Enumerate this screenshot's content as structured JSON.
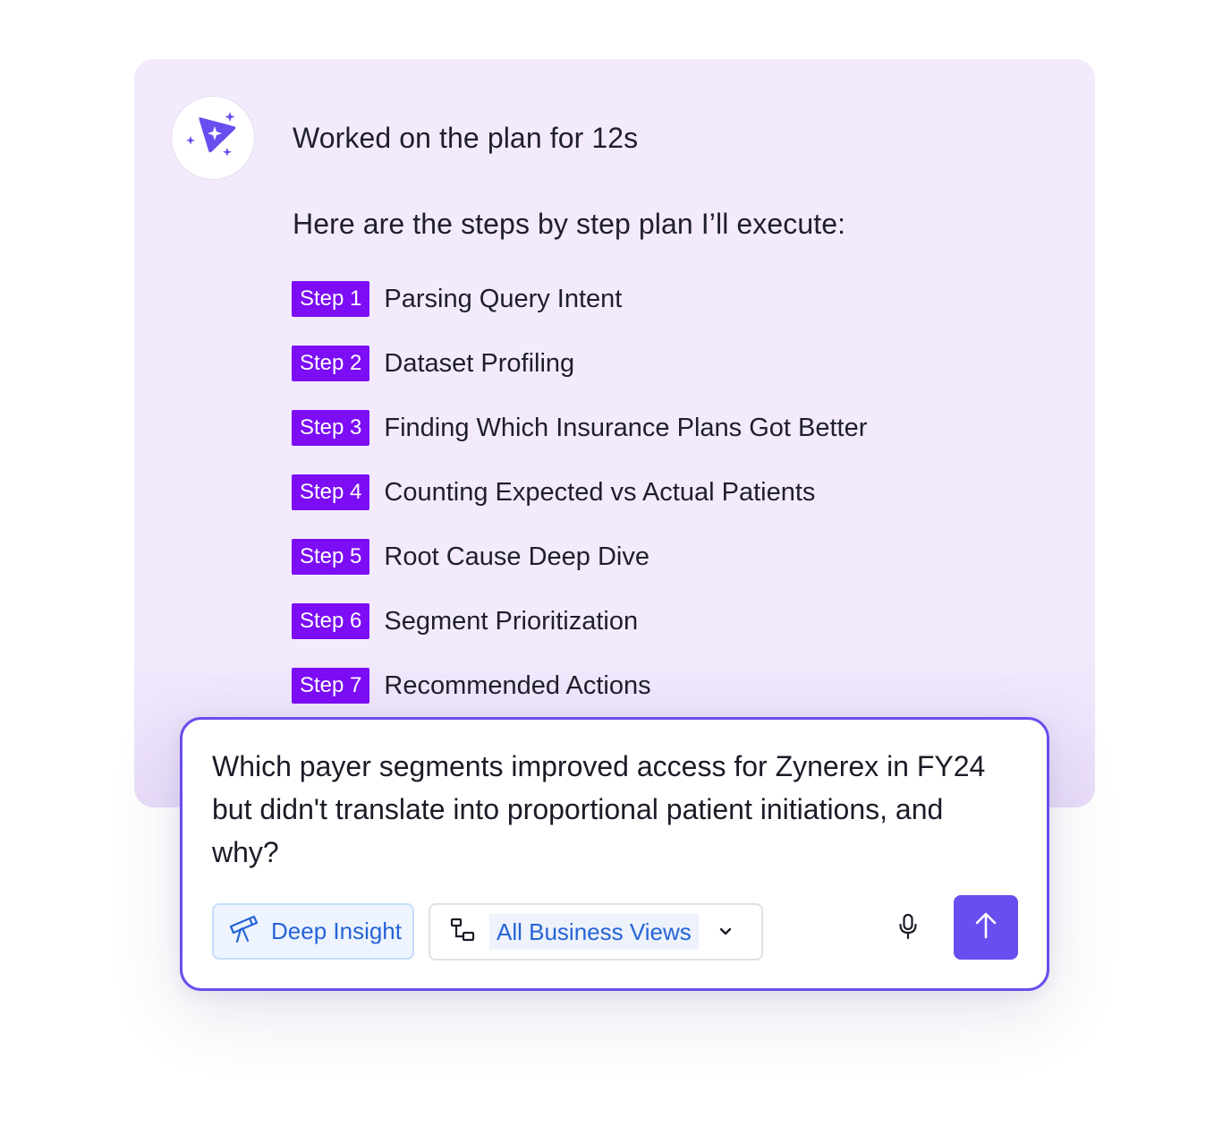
{
  "plan": {
    "status": "Worked on the plan for 12s",
    "intro": "Here are the steps by step plan I’ll execute:",
    "steps": [
      {
        "badge": "Step 1",
        "label": "Parsing Query Intent"
      },
      {
        "badge": "Step 2",
        "label": "Dataset Profiling"
      },
      {
        "badge": "Step 3",
        "label": "Finding Which Insurance Plans Got Better"
      },
      {
        "badge": "Step 4",
        "label": "Counting Expected vs Actual Patients"
      },
      {
        "badge": "Step 5",
        "label": "Root Cause Deep Dive"
      },
      {
        "badge": "Step 6",
        "label": "Segment Prioritization"
      },
      {
        "badge": "Step 7",
        "label": "Recommended Actions"
      }
    ]
  },
  "prompt": {
    "text": "Which payer segments improved access for Zynerex in FY24 but didn't translate into proportional patient initiations, and why?",
    "mode_chip": {
      "label": "Deep Insight",
      "icon": "telescope-icon"
    },
    "views_select": {
      "value": "All Business Views",
      "icon": "hierarchy-icon"
    },
    "mic_icon": "microphone-icon",
    "send_icon": "arrow-up-icon"
  },
  "colors": {
    "card_bg": "#f3ebfd",
    "step_badge": "#7c0df5",
    "accent": "#6a4dee",
    "link_blue": "#2563d6"
  }
}
